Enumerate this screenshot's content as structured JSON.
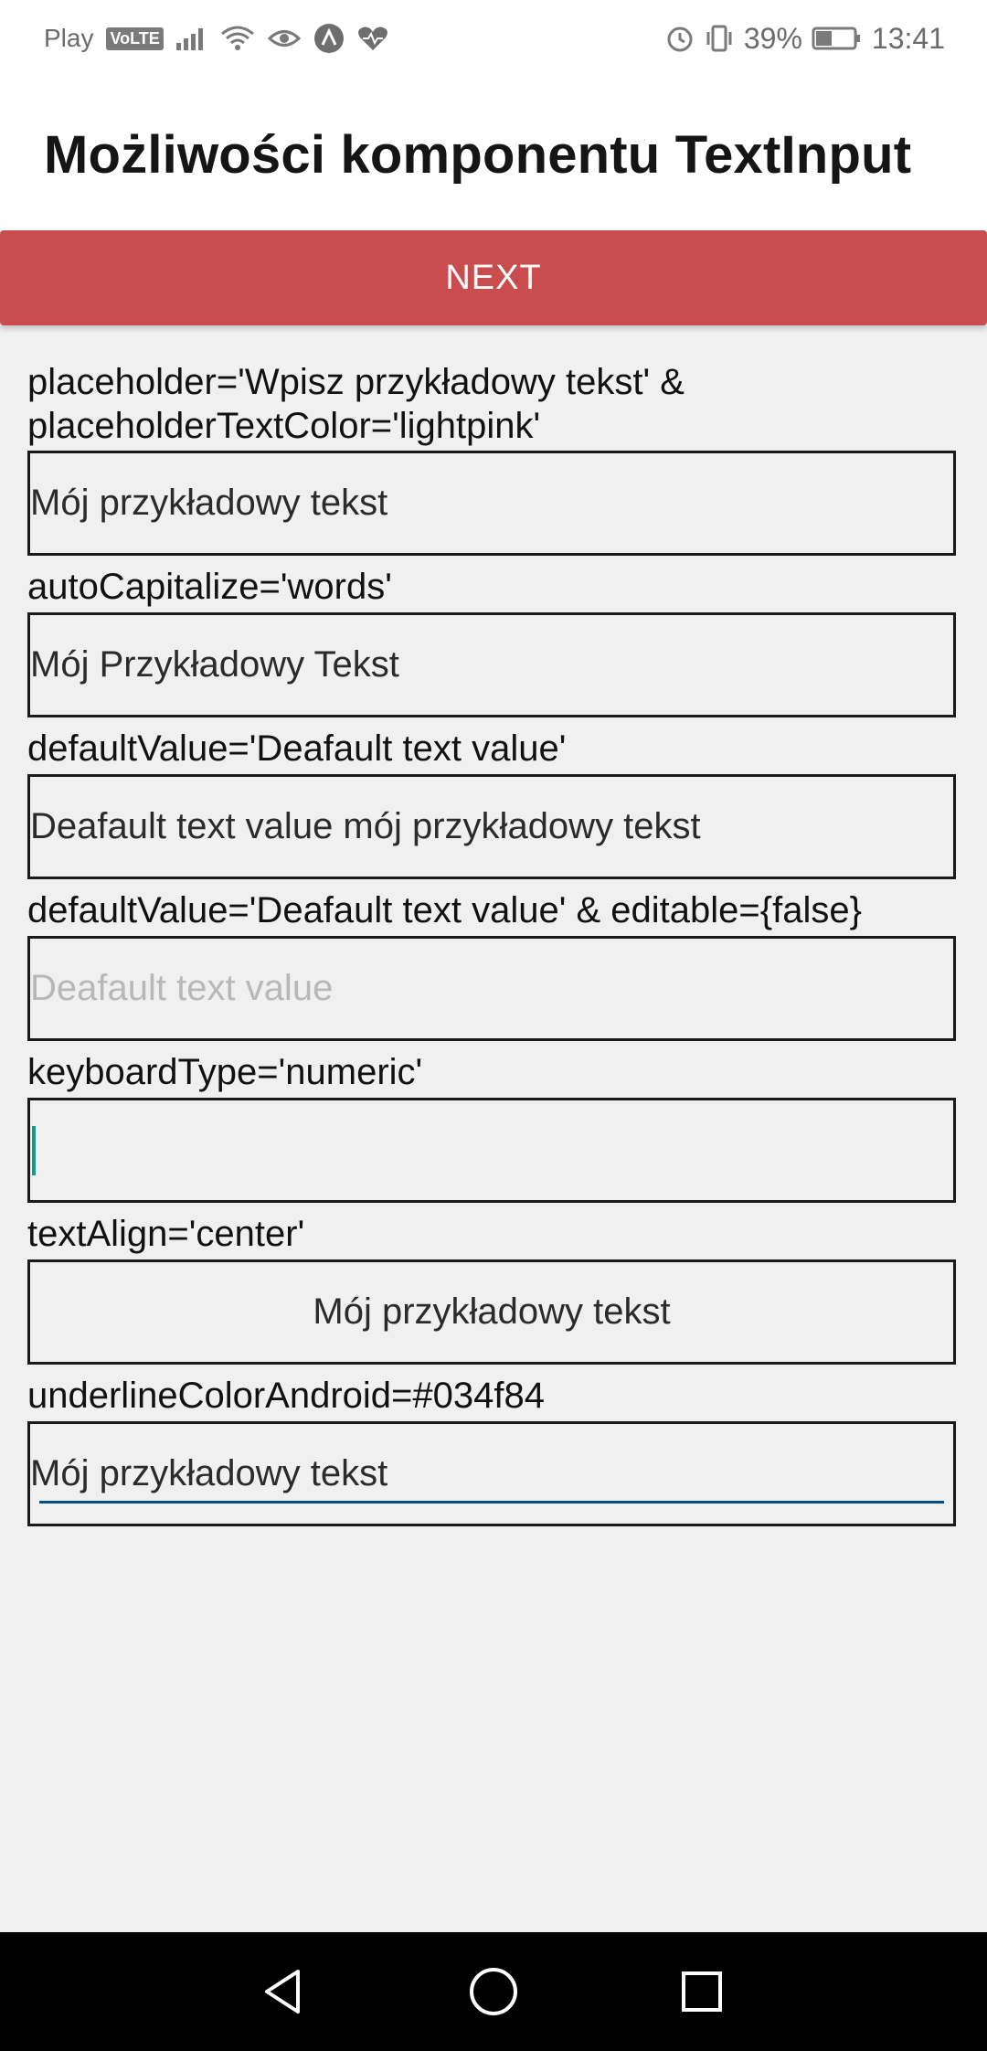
{
  "status_bar": {
    "carrier": "Play",
    "volte": "VoLTE",
    "battery": "39%",
    "time": "13:41"
  },
  "app": {
    "title": "Możliwości komponentu TextInput"
  },
  "next_button": {
    "label": "NEXT"
  },
  "sections": [
    {
      "label_line1": "placeholder='Wpisz przykładowy tekst' &",
      "label_line2": "placeholderTextColor='lightpink'",
      "value": "Mój przykładowy tekst"
    },
    {
      "label": "autoCapitalize='words'",
      "value": "Mój Przykładowy Tekst"
    },
    {
      "label": "defaultValue='Deafault text value'",
      "value": "Deafault text value mój przykładowy tekst"
    },
    {
      "label": "defaultValue='Deafault text value' & editable={false}",
      "value": "Deafault text value"
    },
    {
      "label": "keyboardType='numeric'",
      "value": ""
    },
    {
      "label": "textAlign='center'",
      "value": "Mój przykładowy tekst"
    },
    {
      "label": "underlineColorAndroid=#034f84",
      "value": "Mój przykładowy tekst"
    }
  ],
  "colors": {
    "accent_button": "#c94c4e",
    "underline": "#034f84",
    "caret": "#129b8a",
    "disabled_text": "#b8b8b8"
  }
}
